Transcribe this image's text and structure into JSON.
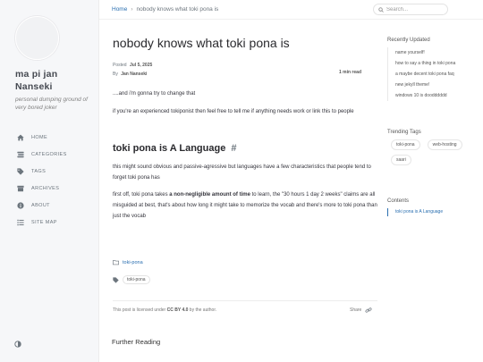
{
  "site": {
    "title": "ma pi jan Nanseki",
    "subtitle": "personal dumping ground of very bored joker"
  },
  "nav": {
    "items": [
      {
        "label": "HOME",
        "icon": "home-icon"
      },
      {
        "label": "CATEGORIES",
        "icon": "stream-icon"
      },
      {
        "label": "TAGS",
        "icon": "tag-icon"
      },
      {
        "label": "ARCHIVES",
        "icon": "archive-icon"
      },
      {
        "label": "ABOUT",
        "icon": "info-icon"
      },
      {
        "label": "SITE MAP",
        "icon": "list-icon"
      }
    ]
  },
  "topbar": {
    "breadcrumb_home": "Home",
    "breadcrumb_sep": "›",
    "breadcrumb_current": "nobody knows what toki pona is",
    "search_placeholder": "Search..."
  },
  "post": {
    "title": "nobody knows what toki pona is",
    "posted_label": "Posted",
    "posted_date": "Jul 5, 2025",
    "by_label": "By",
    "author": "Jan Nanseki",
    "read_time": "1 min read",
    "intro": "....and i'm gonna try to change that",
    "intro2": "if you're an experienced tokiponist then feel free to tell me if anything needs work or link this to people",
    "section_heading": "toki pona is A Language",
    "section_anchor": "#",
    "section_p1": "this might sound obvious and passive-agressive but languages have a few characteristics that people tend to forget toki pona has",
    "section_p2_a": "first off, toki pona takes ",
    "section_p2_bold": "a non-negligible amount of time",
    "section_p2_b": " to learn, the \"30 hours 1 day 2 weeks\" claims are all misguided at best, that's about how long it might take to memorize the vocab and there's more to toki pona than just the vocab",
    "category": "toki-pona",
    "tag": "toki-pona",
    "license_a": "This post is licensed under ",
    "license_b": "CC BY 4.0",
    "license_c": " by the author.",
    "share_label": "Share",
    "further_reading": "Further Reading"
  },
  "panel": {
    "recent_title": "Recently Updated",
    "recent": [
      "name yourself!",
      "how to say a thing in toki pona",
      "a maybe decent toki pona faq",
      "new jekyll theme!",
      "windows 10 is doodddddd"
    ],
    "tags_title": "Trending Tags",
    "tags": [
      "toki-pona",
      "web-hosting",
      "saari"
    ],
    "contents_title": "Contents",
    "contents": [
      "toki pona is A Language"
    ]
  },
  "colors": {
    "link": "#2a6fb0",
    "sidebar_bg": "#f6f7f9"
  }
}
